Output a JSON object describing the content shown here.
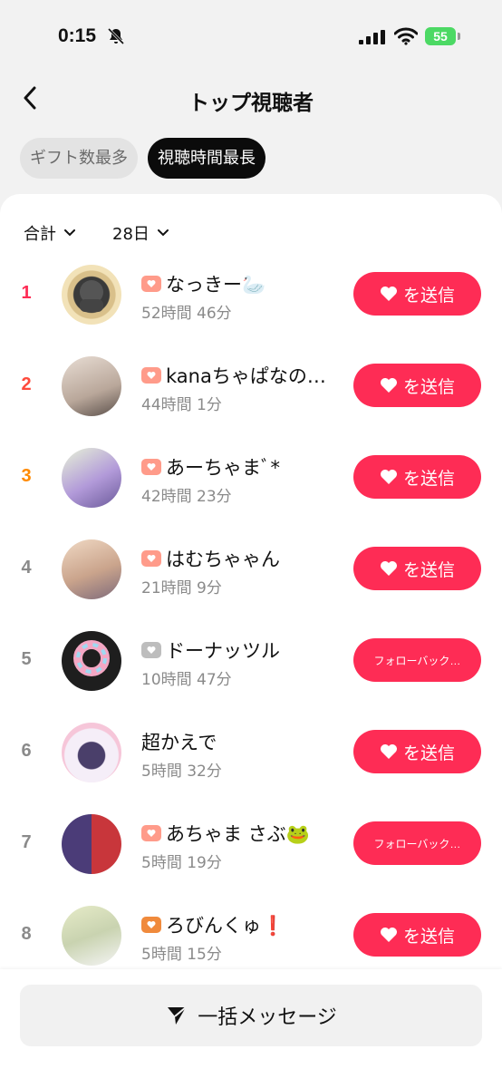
{
  "status": {
    "time": "0:15",
    "battery": "55"
  },
  "header": {
    "title": "トップ視聴者"
  },
  "tabs": [
    {
      "label": "ギフト数最多",
      "active": false
    },
    {
      "label": "視聴時間最長",
      "active": true
    }
  ],
  "filters": {
    "total": "合計",
    "period": "28日"
  },
  "viewers": [
    {
      "rank": "1",
      "rank_color": "#fe2c55",
      "badge_color": "#ff9b8a",
      "name": "なっきー🦢",
      "duration": "52時間 46分",
      "button": "を送信",
      "button_type": "gift"
    },
    {
      "rank": "2",
      "rank_color": "#fe4a3c",
      "badge_color": "#ff9b8a",
      "name": "kanaちゃぱなの…",
      "duration": "44時間 1分",
      "button": "を送信",
      "button_type": "gift"
    },
    {
      "rank": "3",
      "rank_color": "#ff8a00",
      "badge_color": "#ff9b8a",
      "name": "あーちゃまﾞ*",
      "duration": "42時間 23分",
      "button": "を送信",
      "button_type": "gift"
    },
    {
      "rank": "4",
      "rank_color": "#8a8a8a",
      "badge_color": "#ff9b8a",
      "name": "はむちゃゃん",
      "duration": "21時間 9分",
      "button": "を送信",
      "button_type": "gift"
    },
    {
      "rank": "5",
      "rank_color": "#8a8a8a",
      "badge_color": "#bdbdbd",
      "name": "ドーナッツル",
      "duration": "10時間 47分",
      "button": "フォローバック…",
      "button_type": "follow"
    },
    {
      "rank": "6",
      "rank_color": "#8a8a8a",
      "badge_color": "",
      "name": "超かえで",
      "duration": "5時間 32分",
      "button": "を送信",
      "button_type": "gift"
    },
    {
      "rank": "7",
      "rank_color": "#8a8a8a",
      "badge_color": "#ff9b8a",
      "name": "あちゃま さぶ🐸",
      "duration": "5時間 19分",
      "button": "フォローバック…",
      "button_type": "follow"
    },
    {
      "rank": "8",
      "rank_color": "#8a8a8a",
      "badge_color": "#f08a3c",
      "name": "ろびんくゅ❗",
      "duration": "5時間 15分",
      "button": "を送信",
      "button_type": "gift"
    }
  ],
  "bulk_message": "一括メッセージ",
  "colors": {
    "accent": "#fe2c55",
    "active_tab": "#0b0b0b"
  }
}
